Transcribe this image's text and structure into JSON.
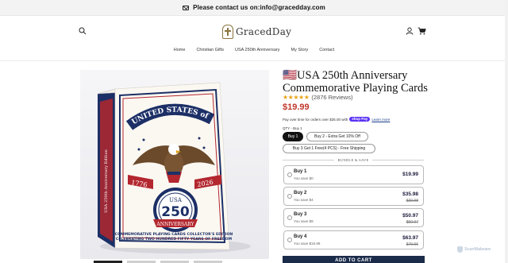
{
  "announcement": {
    "text": "Please contact us on:info@gracedday.com"
  },
  "header": {
    "logo_text": "GracedDay",
    "nav": [
      "Home",
      "Christian Gifts",
      "USA 250th Anniversary",
      "My Story",
      "Contact"
    ]
  },
  "product": {
    "title": "🇺🇸USA 250th Anniversary Commemorative Playing Cards",
    "rating_count": "(2876 Reviews)",
    "stars": "★★★★★",
    "price": "$19.99",
    "installments": {
      "text": "Pay over time for orders over $35.00 with",
      "brand": "shop Pay",
      "learn_more": "Learn more"
    },
    "qty_label": "QTY - Buy 1",
    "qty_options": [
      "Buy 1",
      "Buy 2 - Extra Get 10% Off",
      "Buy 3 Get 1 Free(4 PCS) - Free Shipping"
    ],
    "bundle_header": "BUNDLE & SAVE",
    "bundles": [
      {
        "name": "Buy 1",
        "save": "You save $0",
        "price": "$19.99",
        "compare": ""
      },
      {
        "name": "Buy 2",
        "save": "You save $4",
        "price": "$35.98",
        "compare": "$39.98"
      },
      {
        "name": "Buy 3",
        "save": "You save $9",
        "price": "$50.97",
        "compare": "$59.97"
      },
      {
        "name": "Buy 4",
        "save": "You save $15.99",
        "price": "$63.97",
        "compare": "$79.96"
      }
    ],
    "add_to_cart": "ADD TO CART",
    "image_text": {
      "brand_arc": "UNITED STATES of AMERICA",
      "year_left": "1776",
      "year_right": "2026",
      "usa": "USA",
      "number": "250",
      "anniversary": "ANNIVERSARY",
      "side_text": "USA 250th Anniversary Edition",
      "bottom_line1": "COMMEMORATIVE PLAYING CARDS COLLECTOR'S EDITION",
      "bottom_line2": "CELEBRATING TWO HUNDRED FIFTY YEARS OF FREEDOM"
    }
  },
  "watermark": "ScanMalware",
  "colors": {
    "price": "#c0392b",
    "cart_button": "#1b2b4a",
    "shop_pay": "#5a31f4",
    "stars": "#e8a317"
  }
}
